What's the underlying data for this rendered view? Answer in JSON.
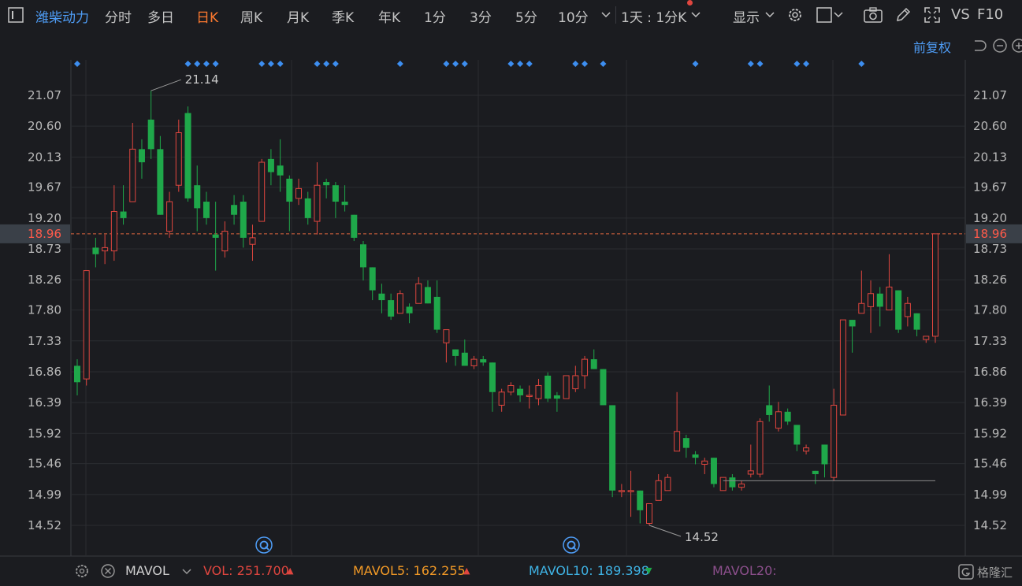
{
  "toolbar": {
    "menu_icon": "menu-box-icon",
    "stock_name": "潍柴动力",
    "tabs": [
      "分时",
      "多日",
      "日K",
      "周K",
      "月K",
      "季K",
      "年K",
      "1分",
      "3分",
      "5分",
      "10分"
    ],
    "active_tab": "日K",
    "more_periods_icon": "chevron-down-icon",
    "interval_select": "1天 : 1分K",
    "display_label": "显示",
    "right_icons": [
      "gear-icon",
      "square-icon",
      "camera-icon",
      "pencil-icon",
      "fullscreen-icon"
    ],
    "vs_label": "VS",
    "f10_label": "F10"
  },
  "subbar": {
    "adjust_label": "前复权",
    "icons": [
      "undo-icon",
      "zoom-out-icon",
      "zoom-in-icon"
    ]
  },
  "chart_data": {
    "type": "candlestick",
    "y_ticks": [
      "21.07",
      "20.60",
      "20.13",
      "19.67",
      "19.20",
      "18.73",
      "18.26",
      "17.80",
      "17.33",
      "16.86",
      "16.39",
      "15.92",
      "15.46",
      "14.99",
      "14.52"
    ],
    "ylim": [
      14.52,
      21.07
    ],
    "current_price": "18.96",
    "high_label": "21.14",
    "low_label": "14.52",
    "support_line": 15.2,
    "up_color": "#e0463f",
    "down_color": "#1fa84a",
    "candles": [
      [
        16.95,
        16.7,
        17.05,
        16.5
      ],
      [
        16.75,
        18.4,
        18.4,
        16.65
      ],
      [
        18.75,
        18.65,
        18.9,
        18.45
      ],
      [
        18.7,
        18.75,
        18.95,
        18.5
      ],
      [
        18.7,
        19.3,
        19.7,
        18.55
      ],
      [
        19.3,
        19.2,
        19.7,
        19.1
      ],
      [
        19.45,
        20.25,
        20.65,
        19.45
      ],
      [
        20.25,
        20.05,
        20.4,
        19.8
      ],
      [
        20.7,
        20.25,
        21.14,
        20.1
      ],
      [
        20.25,
        19.25,
        20.45,
        19.25
      ],
      [
        19.0,
        19.45,
        19.6,
        18.9
      ],
      [
        19.7,
        20.5,
        20.7,
        19.6
      ],
      [
        20.8,
        19.5,
        20.9,
        19.45
      ],
      [
        19.7,
        19.35,
        20.0,
        19.0
      ],
      [
        19.45,
        19.2,
        19.6,
        19.1
      ],
      [
        18.95,
        18.9,
        19.45,
        18.4
      ],
      [
        18.7,
        19.0,
        19.15,
        18.6
      ],
      [
        19.4,
        19.25,
        19.55,
        19.1
      ],
      [
        19.45,
        18.9,
        19.55,
        18.75
      ],
      [
        18.8,
        18.9,
        19.1,
        18.55
      ],
      [
        19.15,
        20.05,
        20.1,
        19.15
      ],
      [
        20.1,
        19.9,
        20.25,
        19.7
      ],
      [
        20.0,
        19.85,
        20.4,
        19.6
      ],
      [
        19.8,
        19.45,
        19.85,
        19.0
      ],
      [
        19.5,
        19.65,
        19.8,
        19.4
      ],
      [
        19.5,
        19.2,
        19.6,
        19.1
      ],
      [
        19.15,
        19.7,
        20.05,
        18.95
      ],
      [
        19.75,
        19.7,
        19.8,
        19.5
      ],
      [
        19.7,
        19.45,
        19.75,
        19.2
      ],
      [
        19.45,
        19.4,
        19.7,
        19.3
      ],
      [
        19.25,
        18.9,
        19.25,
        18.85
      ],
      [
        18.8,
        18.45,
        18.85,
        18.25
      ],
      [
        18.45,
        18.1,
        18.45,
        17.95
      ],
      [
        18.05,
        17.95,
        18.2,
        17.75
      ],
      [
        17.95,
        17.7,
        18.05,
        17.65
      ],
      [
        17.75,
        18.05,
        18.1,
        17.75
      ],
      [
        17.85,
        17.75,
        17.9,
        17.6
      ],
      [
        17.9,
        18.2,
        18.3,
        17.9
      ],
      [
        18.15,
        17.9,
        18.25,
        17.9
      ],
      [
        18.0,
        17.5,
        18.25,
        17.45
      ],
      [
        17.3,
        17.5,
        17.5,
        17.0
      ],
      [
        17.2,
        17.1,
        17.2,
        16.95
      ],
      [
        17.15,
        16.95,
        17.35,
        16.95
      ],
      [
        16.95,
        17.05,
        17.1,
        16.9
      ],
      [
        17.05,
        17.0,
        17.1,
        16.95
      ],
      [
        17.0,
        16.55,
        17.0,
        16.25
      ],
      [
        16.35,
        16.55,
        16.6,
        16.25
      ],
      [
        16.55,
        16.65,
        16.7,
        16.5
      ],
      [
        16.6,
        16.5,
        16.65,
        16.4
      ],
      [
        16.5,
        16.5,
        16.65,
        16.3
      ],
      [
        16.45,
        16.65,
        16.75,
        16.35
      ],
      [
        16.8,
        16.45,
        16.85,
        16.4
      ],
      [
        16.5,
        16.45,
        16.55,
        16.25
      ],
      [
        16.45,
        16.8,
        16.8,
        16.45
      ],
      [
        16.6,
        16.8,
        16.95,
        16.55
      ],
      [
        16.8,
        17.05,
        17.1,
        16.6
      ],
      [
        17.05,
        16.9,
        17.2,
        16.9
      ],
      [
        16.9,
        16.35,
        16.9,
        16.35
      ],
      [
        16.35,
        15.05,
        16.35,
        14.95
      ],
      [
        15.05,
        15.05,
        15.15,
        14.95
      ],
      [
        15.05,
        15.05,
        15.35,
        14.65
      ],
      [
        15.05,
        14.75,
        15.05,
        14.55
      ],
      [
        14.55,
        14.85,
        14.85,
        14.52
      ],
      [
        14.9,
        15.2,
        15.3,
        14.9
      ],
      [
        15.05,
        15.25,
        15.3,
        15.05
      ],
      [
        15.65,
        15.95,
        16.55,
        15.65
      ],
      [
        15.85,
        15.7,
        15.9,
        15.55
      ],
      [
        15.6,
        15.55,
        15.65,
        15.45
      ],
      [
        15.45,
        15.5,
        15.55,
        15.3
      ],
      [
        15.55,
        15.15,
        15.55,
        15.1
      ],
      [
        15.05,
        15.25,
        15.25,
        15.05
      ],
      [
        15.25,
        15.1,
        15.3,
        15.05
      ],
      [
        15.1,
        15.15,
        15.2,
        15.05
      ],
      [
        15.3,
        15.35,
        15.75,
        15.25
      ],
      [
        15.3,
        16.1,
        16.15,
        15.25
      ],
      [
        16.35,
        16.2,
        16.65,
        16.1
      ],
      [
        16.0,
        16.25,
        16.4,
        15.95
      ],
      [
        16.25,
        16.1,
        16.3,
        16.05
      ],
      [
        16.05,
        15.75,
        16.05,
        15.65
      ],
      [
        15.65,
        15.7,
        15.75,
        15.6
      ],
      [
        15.35,
        15.3,
        15.35,
        15.15
      ],
      [
        15.75,
        15.45,
        15.75,
        15.25
      ],
      [
        15.25,
        16.35,
        16.6,
        15.2
      ],
      [
        16.2,
        17.65,
        17.65,
        16.2
      ],
      [
        17.65,
        17.55,
        17.65,
        17.15
      ],
      [
        17.75,
        17.9,
        18.4,
        17.75
      ],
      [
        17.85,
        18.05,
        18.25,
        17.45
      ],
      [
        18.05,
        17.85,
        18.15,
        17.55
      ],
      [
        17.8,
        18.15,
        18.65,
        17.8
      ],
      [
        18.1,
        17.5,
        18.1,
        17.45
      ],
      [
        17.7,
        17.9,
        18.0,
        17.55
      ],
      [
        17.75,
        17.5,
        17.75,
        17.4
      ],
      [
        17.35,
        17.4,
        17.4,
        17.3
      ],
      [
        17.4,
        18.96,
        18.96,
        17.3
      ]
    ]
  },
  "volume_bar": {
    "indicator": "MAVOL",
    "vol_label": "VOL: 251.700",
    "vol_arrow": "▲",
    "mavol5_label": "MAVOL5: 162.255",
    "mavol5_arrow": "▲",
    "mavol10_label": "MAVOL10: 189.398",
    "mavol10_arrow": "▼",
    "mavol20_label": "MAVOL20:",
    "watermark": "格隆汇"
  }
}
